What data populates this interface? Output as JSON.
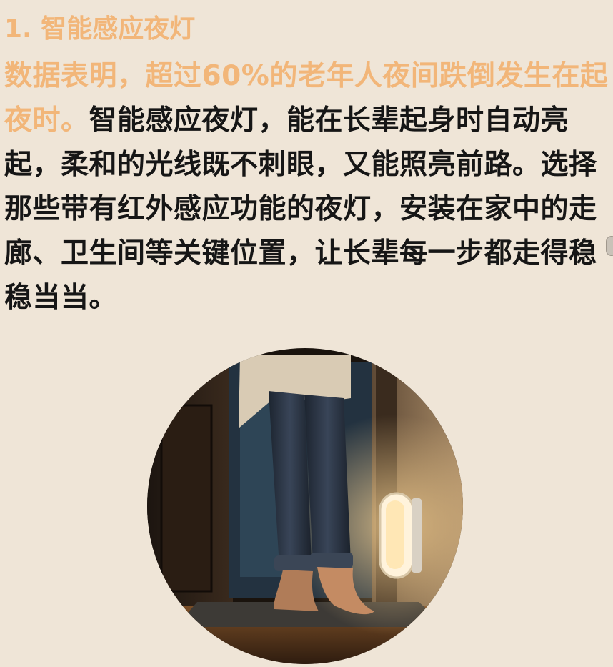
{
  "colors": {
    "accent": "#f2b679",
    "background": "#efe5d7",
    "text": "#161616"
  },
  "heading": "1. 智能感应夜灯",
  "paragraph": {
    "highlight": "数据表明，超过60%的老年人夜间跌倒发生在起夜时。",
    "body": "智能感应夜灯，能在长辈起身时自动亮起，柔和的光线既不刺眼，又能照亮前路。选择那些带有红外感应功能的夜灯，安装在家中的走廊、卫生间等关键位置，让长辈每一步都走得稳稳当当。"
  },
  "image": {
    "icon": "night-light-photo"
  }
}
